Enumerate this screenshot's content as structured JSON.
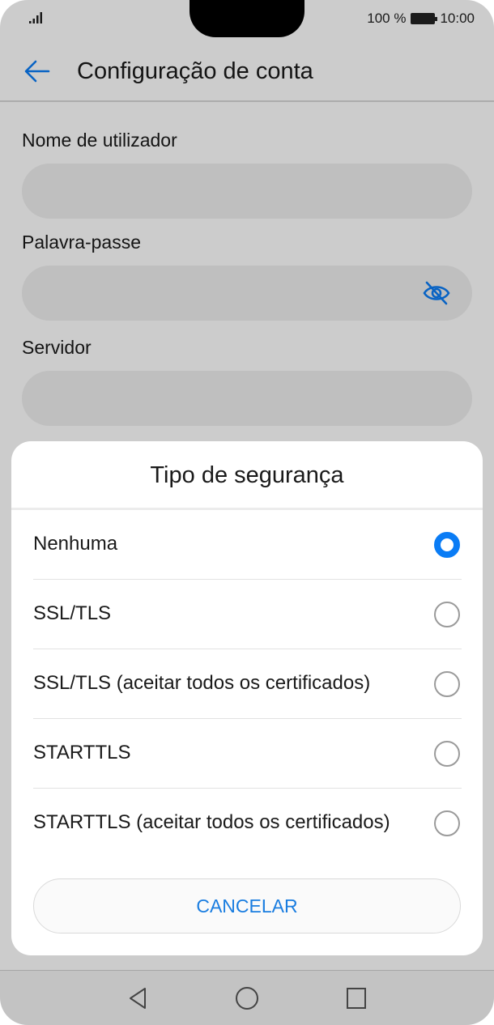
{
  "status_bar": {
    "battery_text": "100 %",
    "time": "10:00"
  },
  "header": {
    "title": "Configuração de conta"
  },
  "form": {
    "username_label": "Nome de utilizador",
    "password_label": "Palavra-passe",
    "server_label": "Servidor"
  },
  "dialog": {
    "title": "Tipo de segurança",
    "options": [
      {
        "label": "Nenhuma",
        "selected": true
      },
      {
        "label": "SSL/TLS",
        "selected": false
      },
      {
        "label": "SSL/TLS (aceitar todos os certificados)",
        "selected": false
      },
      {
        "label": "STARTTLS",
        "selected": false
      },
      {
        "label": "STARTTLS (aceitar todos os certificados)",
        "selected": false
      }
    ],
    "cancel_label": "CANCELAR"
  },
  "colors": {
    "accent": "#0a7cf5",
    "cancel_text": "#1a7de0",
    "scrim": "rgba(0,0,0,0.2)"
  }
}
